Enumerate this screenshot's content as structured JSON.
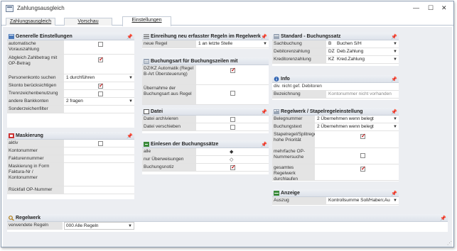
{
  "window": {
    "title": "Zahlungsausgleich",
    "minimize": "—",
    "maximize": "☐",
    "close": "✕"
  },
  "tabs": [
    "Zahlungsausgleich",
    "Vorschau",
    "Einstellungen"
  ],
  "general": {
    "title": "Generelle Einstellungen",
    "rows": [
      {
        "label": "automatische Vorauszahlung",
        "type": "checkbox",
        "checked": false
      },
      {
        "label": "Abgleich Zahlbetrag mit OP-Betrag",
        "type": "checkbox",
        "checked": true
      },
      {
        "label": "Personenkonto suchen",
        "type": "select",
        "value": "1 durchführen"
      },
      {
        "label": "Skonto berücksichtigen",
        "type": "checkbox",
        "checked": true
      },
      {
        "label": "Trennzeichenbenutzung",
        "type": "checkbox",
        "checked": false
      },
      {
        "label": "andere Bankkonten",
        "type": "select",
        "value": "2 fragen"
      },
      {
        "label": "Sonderzeichenfilter",
        "type": "text",
        "value": ""
      }
    ]
  },
  "masking": {
    "title": "Maskierung",
    "rows": [
      {
        "label": "aktiv",
        "type": "checkbox",
        "checked": false
      },
      {
        "label": "Kontonummer",
        "value": ""
      },
      {
        "label": "Fakturennummer",
        "value": ""
      },
      {
        "label": "Maskierung in Form Faktura-Nr / Kontonummer",
        "value": ""
      },
      {
        "label": "Rückfall OP-Nummer",
        "value": ""
      }
    ]
  },
  "newRules": {
    "title": "Einreihung neu erfasster Regeln im Regelwerk",
    "rows": [
      {
        "label": "neue Regel",
        "value": "1 an letzte Stelle"
      }
    ]
  },
  "bookingType": {
    "title": "Buchungsart für Buchungszeilen mit Personenkonten",
    "rows": [
      {
        "label": "DZ/KZ Automatik (Regel B-Art Übersteuerung)",
        "checked": true
      },
      {
        "label": "Übernahme der Buchungsart aus Regel",
        "checked": false
      }
    ]
  },
  "file": {
    "title": "Datei",
    "rows": [
      {
        "label": "Datei archivieren",
        "checked": false
      },
      {
        "label": "Datei verschieben",
        "checked": false
      }
    ]
  },
  "reading": {
    "title": "Einlesen der Buchungssätze",
    "rows": [
      {
        "label": "alle",
        "type": "radio",
        "symbol": "◆"
      },
      {
        "label": "nur Überweisungen",
        "type": "radio",
        "symbol": "◇"
      },
      {
        "label": "Buchungsnotiz",
        "type": "checkbox",
        "checked": true
      }
    ]
  },
  "standard": {
    "title": "Standard - Buchungssatz",
    "rows": [
      {
        "label": "Sachbuchung",
        "code": "B",
        "value": "Buchen S/H"
      },
      {
        "label": "Debitorenzahlung",
        "code": "DZ",
        "value": "Deb.Zahlung"
      },
      {
        "label": "Kreditorenzahlung",
        "code": "KZ",
        "value": "Kred.Zahlung"
      }
    ]
  },
  "info": {
    "title": "Info",
    "rows": [
      {
        "label": "div. nicht gef. Debitoren",
        "value": ""
      },
      {
        "label": "Bezeichnung",
        "value": "Kontonummer nicht vorhanden"
      }
    ]
  },
  "ruleset": {
    "title": "Regelwerk / Stapelregeleinstellung",
    "rows": [
      {
        "label": "Belegnummer",
        "type": "select",
        "value": "2 Übernehmen wenn belegt"
      },
      {
        "label": "Buchungstext",
        "type": "select",
        "value": "2 Übernehmen wenn belegt"
      },
      {
        "label": "Stapelregel/Splitregel hohe Priorität",
        "type": "checkbox",
        "checked": true
      },
      {
        "label": "mehrfache OP-Nummersuche",
        "type": "checkbox",
        "checked": false
      },
      {
        "label": "gesamtes Regelwerk durchlaufen",
        "type": "checkbox",
        "checked": true
      }
    ]
  },
  "display": {
    "title": "Anzeige",
    "rows": [
      {
        "label": "Auszug",
        "value": "Kontrollsumme Soll/Haben;Au"
      }
    ]
  },
  "regelwerk": {
    "title": "Regelwerk",
    "rows": [
      {
        "label": "verwendete Regeln",
        "value": "000 Alle Regeln"
      }
    ]
  },
  "colors": {
    "accent": "#c01818",
    "labelBg": "#e4e4e4",
    "headerBg": "#dde2ea"
  },
  "icons": {
    "pin": "pin-icon",
    "dropdown": "chevron-down-icon"
  }
}
